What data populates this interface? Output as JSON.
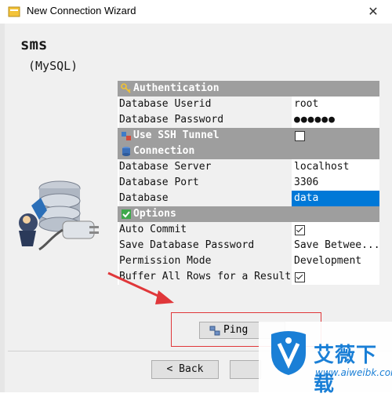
{
  "window": {
    "title": "New Connection Wizard",
    "close_glyph": "✕"
  },
  "connection": {
    "name": "sms",
    "type_label": "(MySQL)"
  },
  "sections": {
    "authentication": "Authentication",
    "ssh": "Use SSH Tunnel",
    "connection": "Connection",
    "options": "Options"
  },
  "props": {
    "userid": {
      "label": "Database Userid",
      "value": "root"
    },
    "password": {
      "label": "Database Password",
      "value": "●●●●●●"
    },
    "server": {
      "label": "Database Server",
      "value": "localhost"
    },
    "port": {
      "label": "Database Port",
      "value": "3306"
    },
    "database": {
      "label": "Database",
      "value": "data"
    },
    "autocommit": {
      "label": "Auto Commit",
      "checked": true
    },
    "save_password": {
      "label": "Save Database Password",
      "value": "Save Betwee..."
    },
    "permission": {
      "label": "Permission Mode",
      "value": "Development"
    },
    "buffer": {
      "label": "Buffer All Rows for a Result",
      "checked": true
    }
  },
  "ssh_tunnel_checked": false,
  "buttons": {
    "ping": "Ping",
    "back": "< Back"
  },
  "watermark": {
    "cn": "艾薇下载",
    "url": "www.aiweibk.com"
  },
  "icons": {
    "app": "wizard-app-icon",
    "key": "key-icon",
    "tunnel": "ssh-tunnel-icon",
    "db": "database-icon",
    "options": "checkmark-icon",
    "ping": "network-icon",
    "illustration": "database-plug-illustration"
  },
  "colors": {
    "section_bg": "#9e9e9e",
    "selected": "#0078d7",
    "highlight_box": "#e0373a",
    "watermark": "#1a7fd6"
  }
}
